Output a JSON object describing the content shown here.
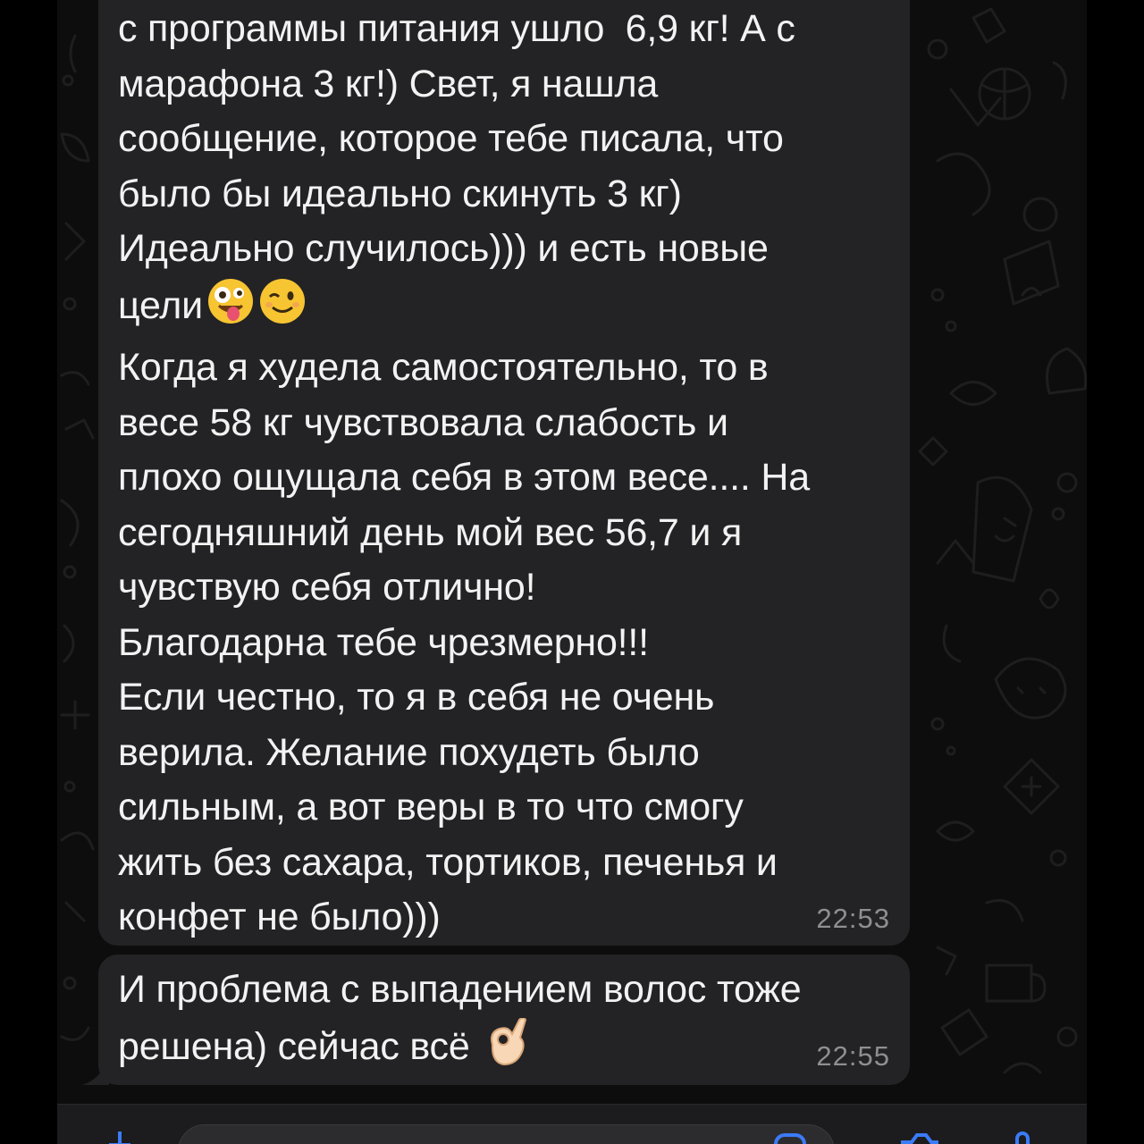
{
  "chat": {
    "messages": [
      {
        "text": "с программы питания ушло  6,9 кг! А с\nмарафона 3 кг!) Свет, я нашла\nсообщение, которое тебе писала, что\nбыло бы идеально скинуть 3 кг)\nИдеально случилось))) и есть новые\nцели",
        "text_after": "Когда я худела самостоятельно, то в\nвесе 58 кг чувствовала слабость и\nплохо ощущала себя в этом весе.... На\nсегодняшний день мой вес 56,7 и я\nчувствую себя отлично!\nБлагодарна тебе чрезмерно!!!\nЕсли честно, то я в себя не очень\nверила. Желание похудеть было\nсильным, а вот веры в то что смогу\nжить без сахара, тортиков, печенья и\nконфет не было)))",
        "emojis": [
          "zany-face-emoji",
          "winking-face-emoji"
        ],
        "time": "22:53"
      },
      {
        "text": "И проблема с выпадением волос тоже\nрешена) сейчас всё",
        "emojis": [
          "ok-hand-emoji"
        ],
        "time": "22:55"
      }
    ]
  },
  "colors": {
    "bubble": "#232325",
    "text": "#f2f2f2",
    "timestamp": "#8e8e93",
    "background": "#0d0d0d"
  },
  "input_bar": {
    "icons": [
      "plus-icon",
      "sticker-icon",
      "camera-icon",
      "microphone-icon"
    ]
  }
}
